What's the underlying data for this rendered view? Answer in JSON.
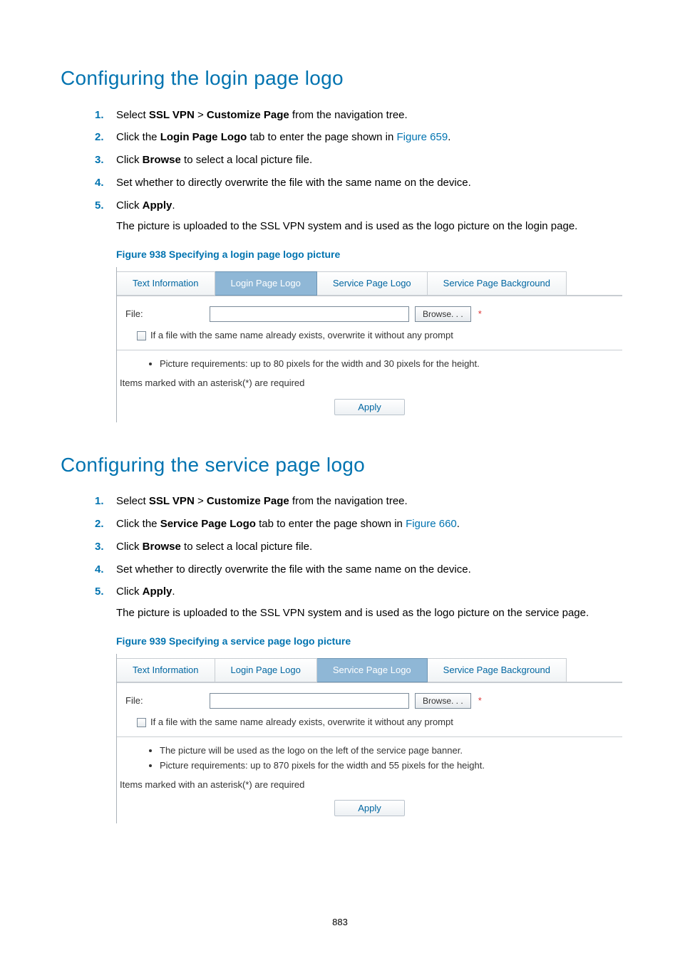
{
  "section1": {
    "heading": "Configuring the login page logo",
    "steps": {
      "s1_a": "Select ",
      "s1_b": "SSL VPN",
      "s1_c": " > ",
      "s1_d": "Customize Page",
      "s1_e": " from the navigation tree.",
      "s2_a": "Click the ",
      "s2_b": "Login Page Logo",
      "s2_c": " tab to enter the page shown in ",
      "s2_link": "Figure 659",
      "s2_d": ".",
      "s3_a": "Click ",
      "s3_b": "Browse",
      "s3_c": " to select a local picture file.",
      "s4": "Set whether to directly overwrite the file with the same name on the device.",
      "s5_a": "Click ",
      "s5_b": "Apply",
      "s5_c": ".",
      "s5_sub": "The picture is uploaded to the SSL VPN system and is used as the logo picture on the login page."
    },
    "fig_caption": "Figure 938 Specifying a login page logo picture",
    "ui": {
      "tabs": {
        "t1": "Text Information",
        "t2": "Login Page Logo",
        "t3": "Service Page Logo",
        "t4": "Service Page Background"
      },
      "file_label": "File:",
      "browse": "Browse. . .",
      "asterisk": "*",
      "overwrite": "If a file with the same name already exists, overwrite it without any prompt",
      "bullet1": "Picture requirements: up to 80 pixels for the width and 30 pixels for the height.",
      "req_note": "Items marked with an asterisk(*) are required",
      "apply": "Apply"
    }
  },
  "section2": {
    "heading": "Configuring the service page logo",
    "steps": {
      "s1_a": "Select ",
      "s1_b": "SSL VPN",
      "s1_c": " > ",
      "s1_d": "Customize Page",
      "s1_e": " from the navigation tree.",
      "s2_a": "Click the ",
      "s2_b": "Service Page Logo",
      "s2_c": " tab to enter the page shown in ",
      "s2_link": "Figure 660",
      "s2_d": ".",
      "s3_a": "Click ",
      "s3_b": "Browse",
      "s3_c": " to select a local picture file.",
      "s4": "Set whether to directly overwrite the file with the same name on the device.",
      "s5_a": "Click ",
      "s5_b": "Apply",
      "s5_c": ".",
      "s5_sub": "The picture is uploaded to the SSL VPN system and is used as the logo picture on the service page."
    },
    "fig_caption": "Figure 939 Specifying a service page logo picture",
    "ui": {
      "tabs": {
        "t1": "Text Information",
        "t2": "Login Page Logo",
        "t3": "Service Page Logo",
        "t4": "Service Page Background"
      },
      "file_label": "File:",
      "browse": "Browse. . .",
      "asterisk": "*",
      "overwrite": "If a file with the same name already exists, overwrite it without any prompt",
      "bullet1": "The picture will be used as the logo on the left of the service page banner.",
      "bullet2": "Picture requirements: up to 870 pixels for the width and 55 pixels for the height.",
      "req_note": "Items marked with an asterisk(*) are required",
      "apply": "Apply"
    }
  },
  "page_num": "883"
}
